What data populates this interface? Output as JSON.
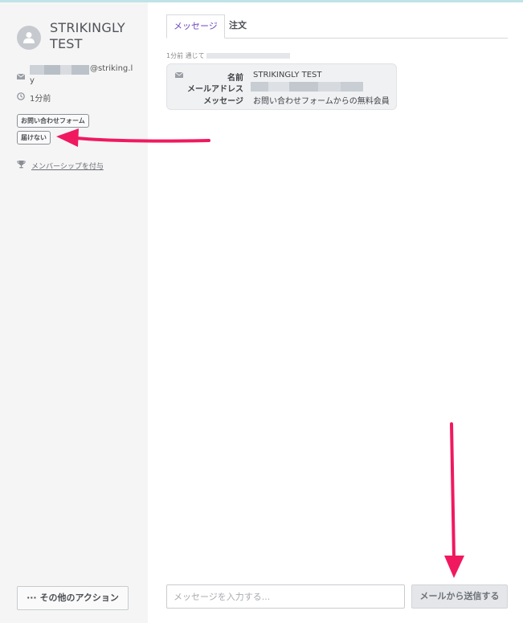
{
  "contact": {
    "name": "STRIKINGLY TEST",
    "email_domain": "@striking.l",
    "email_wrap": "y",
    "time": "1分前",
    "tags": [
      "お問い合わせフォーム",
      "届けない"
    ],
    "membership_link": "メンバーシップを付与",
    "more_actions": "··· その他のアクション"
  },
  "tabs": [
    {
      "label": "メッセージ",
      "active": true
    },
    {
      "label": "注文",
      "active": false
    }
  ],
  "message": {
    "meta": "1分前 通じて",
    "fields": [
      {
        "label": "名前",
        "value": "STRIKINGLY TEST"
      },
      {
        "label": "メールアドレス",
        "value": ""
      },
      {
        "label": "メッセージ",
        "value": "お問い合わせフォームからの無料会員"
      }
    ]
  },
  "compose": {
    "placeholder": "メッセージを入力する...",
    "send_label": "メールから送信する"
  },
  "icons": [
    "user-avatar-icon",
    "mail-icon",
    "clock-icon",
    "trophy-icon"
  ],
  "colors": {
    "accent": "#6c48c0",
    "annotation_arrow": "#f0195f",
    "sidebar_bg": "#f5f5f6"
  }
}
